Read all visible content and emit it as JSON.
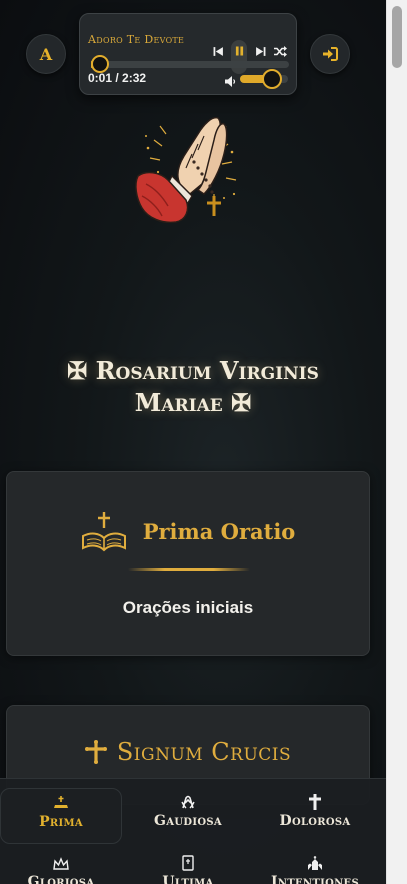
{
  "header": {
    "font_toggle_label": "A",
    "login_icon": "sign-in-icon"
  },
  "player": {
    "track_title": "Adoro Te Devote",
    "time": "0:01 / 2:32",
    "progress_fraction": 0.0066,
    "volume_fraction": 0.67,
    "icons": [
      "skip-back-icon",
      "pause-icon",
      "skip-forward-icon",
      "shuffle-icon",
      "volume-icon"
    ]
  },
  "hero": {
    "title_line1": "✠ Rosarium Virginis",
    "title_line2": "Mariae ✠"
  },
  "cards": [
    {
      "title": "Prima Oratio",
      "subtitle": "Orações iniciais",
      "icon": "bible-cross-icon"
    },
    {
      "title": "Signum Crucis",
      "icon": "cross-icon"
    }
  ],
  "nav": {
    "items": [
      {
        "label": "Prima",
        "icon": "altar-icon",
        "active": true
      },
      {
        "label": "Gaudiosa",
        "icon": "praying-hands-icon",
        "active": false
      },
      {
        "label": "Dolorosa",
        "icon": "cross-icon",
        "active": false
      },
      {
        "label": "Gloriosa",
        "icon": "crown-icon",
        "active": false
      },
      {
        "label": "Ultima",
        "icon": "book-icon",
        "active": false
      },
      {
        "label": "Intentiones",
        "icon": "church-icon",
        "active": false
      }
    ]
  },
  "colors": {
    "accent": "#e0ad3e",
    "background": "#121719",
    "card": "#25282a"
  }
}
